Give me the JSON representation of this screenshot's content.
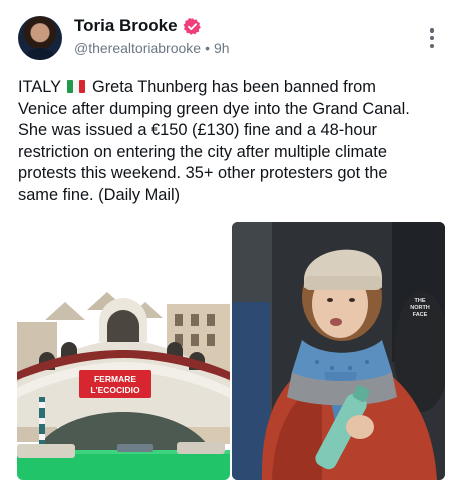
{
  "author": {
    "display_name": "Toria Brooke",
    "handle": "@therealtoriabrooke",
    "separator": "•",
    "time": "9h"
  },
  "icons": {
    "avatar": "profile-photo",
    "verified": "verified-badge-icon",
    "more": "more-vertical-icon",
    "flag": "italy-flag-icon"
  },
  "colors": {
    "badge": "#f03e7a",
    "muted_text": "#6b7785",
    "canal_green": "#22c46a",
    "banner_red": "#d7262f"
  },
  "post": {
    "line1_pre": "ITALY",
    "line1_post": "Greta Thunberg has been banned from",
    "line2": "Venice after dumping green dye into the Grand Canal.",
    "line3": "She was issued a €150 (£130) fine and a 48-hour",
    "line4": "restriction on entering the city after multiple climate",
    "line5": "protests this weekend. 35+ other protesters got the",
    "line6": "same fine. (Daily Mail)"
  },
  "media": {
    "left_banner_line1": "FERMARE",
    "left_banner_line2": "L'ECOCIDIO",
    "right_jacket_logo_line1": "THE",
    "right_jacket_logo_line2": "NORTH",
    "right_jacket_logo_line3": "FACE"
  }
}
